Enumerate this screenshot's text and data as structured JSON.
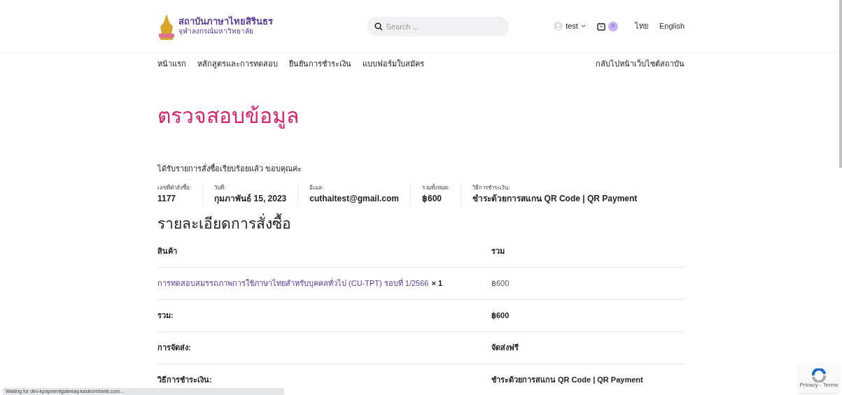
{
  "header": {
    "logo_title": "สถาบันภาษาไทยสิรินธร",
    "logo_subtitle": "จุฬาลงกรณ์มหาวิทยาลัย",
    "search": {
      "placeholder": "Search ..."
    },
    "user": "test",
    "cart_count": "0",
    "languages": [
      "ไทย",
      "English"
    ]
  },
  "nav": {
    "items": [
      "หน้าแรก",
      "หลักสูตรและการทดสอบ",
      "ยืนยันการชำระเงิน",
      "แบบฟอร์มใบสมัคร"
    ],
    "back_link": "กลับไปหน้าเว็บไซต์สถาบัน"
  },
  "page_title": "ตรวจสอบข้อมูล",
  "thank_you": "ได้รับรายการสั่งซื้อเรียบร้อยแล้ว ขอบคุณค่ะ",
  "overview": [
    {
      "label": "เลขที่คำสั่งซื้อ:",
      "value": "1177"
    },
    {
      "label": "วันที่:",
      "value": "กุมภาพันธ์ 15, 2023"
    },
    {
      "label": "อีเมล:",
      "value": "cuthaitest@gmail.com"
    },
    {
      "label": "รวมทั้งหมด:",
      "value": "฿600"
    },
    {
      "label": "วิธีการชำระเงิน:",
      "value": "ชำระด้วยการสแกน QR Code | QR Payment"
    }
  ],
  "details_heading": "รายละเอียดการสั่งซื้อ",
  "table": {
    "columns": [
      "สินค้า",
      "รวม"
    ],
    "rows": [
      {
        "kind": "item",
        "product": "การทดสอบสมรรถภาพการใช้ภาษาไทยสำหรับบุคคลทั่วไป (CU-TPT) รอบที่ 1/2566",
        "quantity": "× 1",
        "total": "฿600"
      },
      {
        "kind": "summary",
        "product": "รวม:",
        "total": "฿600"
      },
      {
        "kind": "summary",
        "product": "การจัดส่ง:",
        "total": "จัดส่งฟรี"
      },
      {
        "kind": "summary",
        "product": "วิธีการชำระเงิน:",
        "total": "ชำระด้วยการสแกน QR Code | QR Payment"
      }
    ]
  },
  "status_bar": "Waiting for dev-kpaymentgateway.kasikornbank.com...",
  "recaptcha": "Privacy - Terms"
}
